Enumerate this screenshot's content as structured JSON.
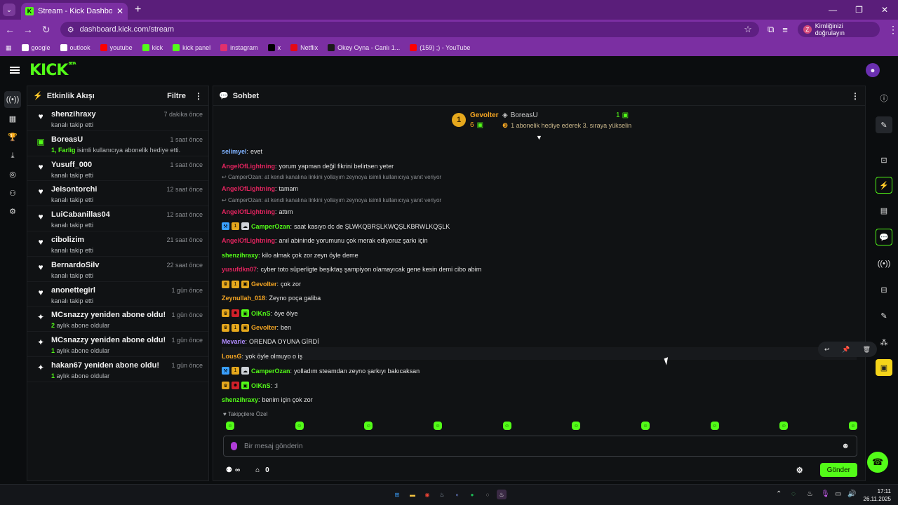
{
  "browser": {
    "tab_title": "Stream - Kick Dashboard",
    "url": "dashboard.kick.com/stream",
    "verify_label": "Kimliğinizi doğrulayın",
    "verify_avatar": "Z",
    "bookmarks": [
      {
        "label": "google",
        "icon": "google-icon",
        "color": "#ffffff"
      },
      {
        "label": "outlook",
        "icon": "outlook-icon",
        "color": "#ffffff"
      },
      {
        "label": "youtube",
        "icon": "youtube-icon",
        "color": "#ff0000"
      },
      {
        "label": "kick",
        "icon": "kick-icon",
        "color": "#53fc18"
      },
      {
        "label": "kick panel",
        "icon": "kick-icon",
        "color": "#53fc18"
      },
      {
        "label": "instagram",
        "icon": "instagram-icon",
        "color": "#e1306c"
      },
      {
        "label": "x",
        "icon": "x-icon",
        "color": "#000000"
      },
      {
        "label": "Netflix",
        "icon": "netflix-icon",
        "color": "#e50914"
      },
      {
        "label": "Okey Oyna - Canlı 1...",
        "icon": "okey-icon",
        "color": "#1a1a1a"
      },
      {
        "label": "(159) ;) - YouTube",
        "icon": "youtube-icon",
        "color": "#ff0000"
      }
    ]
  },
  "kick": {
    "logo": "KICK",
    "beta": "BETA"
  },
  "activity": {
    "title": "Etkinlik Akışı",
    "filter_label": "Filtre",
    "events": [
      {
        "icon": "heart-icon",
        "name": "shenzihraxy",
        "desc": "kanalı takip etti",
        "time": "7 dakika önce"
      },
      {
        "icon": "gift-icon",
        "name": "BoreasU",
        "desc_highlight": "1, Farlig",
        "desc": "isimli kullanıcıya abonelik hediye etti.",
        "time": "1 saat önce"
      },
      {
        "icon": "heart-icon",
        "name": "Yusuff_000",
        "desc": "kanalı takip etti",
        "time": "1 saat önce"
      },
      {
        "icon": "heart-icon",
        "name": "Jeisontorchi",
        "desc": "kanalı takip etti",
        "time": "12 saat önce"
      },
      {
        "icon": "heart-icon",
        "name": "LuiCabanillas04",
        "desc": "kanalı takip etti",
        "time": "12 saat önce"
      },
      {
        "icon": "heart-icon",
        "name": "cibolizim",
        "desc": "kanalı takip etti",
        "time": "21 saat önce"
      },
      {
        "icon": "heart-icon",
        "name": "BernardoSilv",
        "desc": "kanalı takip etti",
        "time": "22 saat önce"
      },
      {
        "icon": "heart-icon",
        "name": "anonettegirl",
        "desc": "kanalı takip etti",
        "time": "1 gün önce"
      },
      {
        "icon": "sparkle-icon",
        "name": "MCsnazzy yeniden abone oldu!",
        "desc_highlight": "2",
        "desc": "aylık abone oldular",
        "time": "1 gün önce"
      },
      {
        "icon": "sparkle-icon",
        "name": "MCsnazzy yeniden abone oldu!",
        "desc_highlight": "1",
        "desc": "aylık abone oldular",
        "time": "1 gün önce"
      },
      {
        "icon": "sparkle-icon",
        "name": "hakan67 yeniden abone oldu!",
        "desc_highlight": "1",
        "desc": "aylık abone oldular",
        "time": "1 gün önce"
      }
    ]
  },
  "chat": {
    "title": "Sohbet",
    "pinned": {
      "rank": "1",
      "leader": "Gevolter",
      "leader_count": "6",
      "gifter": "BoreasU",
      "gifter_count": "1",
      "gifter_note": "1 abonelik hediye ederek 3. sıraya yükselin"
    },
    "messages": [
      {
        "user": "selimyel",
        "color": "#7fb2ff",
        "text": "evet",
        "badges": []
      },
      {
        "user": "AngelOfLightning",
        "color": "#e0245e",
        "text": "yorum yapman değil fikrini belirtsen yeter",
        "badges": []
      },
      {
        "reply": "CamperOzan: at kendi kanalına linkini yollayım zeynoya isimli kullanıcıya yanıt veriyor",
        "user": "AngelOfLightning",
        "color": "#e0245e",
        "text": "tamam",
        "badges": []
      },
      {
        "reply": "CamperOzan: at kendi kanalına linkini yollayım zeynoya isimli kullanıcıya yanıt veriyor",
        "user": "AngelOfLightning",
        "color": "#e0245e",
        "text": "attım",
        "badges": []
      },
      {
        "user": "CamperOzan",
        "color": "#53fc18",
        "text": "saat kasıyo dc de ŞLWKQBRŞLKWQŞLKBRWLKQŞLK",
        "badges": [
          "tool",
          "coin",
          "cloud"
        ]
      },
      {
        "user": "AngelOfLightning",
        "color": "#e0245e",
        "text": "anıl abininde yorumunu çok merak ediyoruz şarkı için",
        "badges": []
      },
      {
        "user": "shenzihraxy",
        "color": "#53fc18",
        "text": "kilo almak çok zor zeyn öyle deme",
        "badges": []
      },
      {
        "user": "yusufdkn07",
        "color": "#e0245e",
        "text": "cyber toto süperligte beşiktaş şampiyon olamayıcak gene kesin demi cibo abim",
        "badges": []
      },
      {
        "user": "Gevolter",
        "color": "#f5a623",
        "text": "çok zor",
        "badges": [
          "crown",
          "coin",
          "gift"
        ]
      },
      {
        "user": "Zeynullah_018",
        "color": "#f5a623",
        "text": "Zeyno poça galiba",
        "badges": []
      },
      {
        "user": "OlKnS",
        "color": "#53fc18",
        "text": "öye ölye",
        "badges": [
          "crown",
          "devil",
          "sub"
        ]
      },
      {
        "user": "Gevolter",
        "color": "#f5a623",
        "text": "ben",
        "badges": [
          "crown",
          "coin",
          "gift"
        ]
      },
      {
        "user": "Mevarie",
        "color": "#b18cff",
        "text": "ORENDA OYUNA GİRDİ",
        "badges": []
      },
      {
        "user": "LousG",
        "color": "#f5a623",
        "text": "yok öyle olmuyo o iş",
        "badges": []
      },
      {
        "user": "CamperOzan",
        "color": "#53fc18",
        "text": "yolladım steamdan zeyno şarkıyı bakıcaksan",
        "badges": [
          "tool",
          "coin",
          "cloud"
        ]
      },
      {
        "user": "OlKnS",
        "color": "#53fc18",
        "text": ":I",
        "badges": [
          "crown",
          "devil",
          "sub"
        ]
      },
      {
        "user": "shenzihraxy",
        "color": "#53fc18",
        "text": "benim için çok zor",
        "badges": []
      }
    ],
    "follower_only": "Takipçilere Özel",
    "input_placeholder": "Bir mesaj gönderin",
    "points": "∞",
    "store_count": "0",
    "send_label": "Gönder"
  },
  "taskbar": {
    "time": "17:11",
    "date": "26.11.2025"
  },
  "colors": {
    "accent": "#53fc18",
    "browser": "#7b2fa2"
  }
}
